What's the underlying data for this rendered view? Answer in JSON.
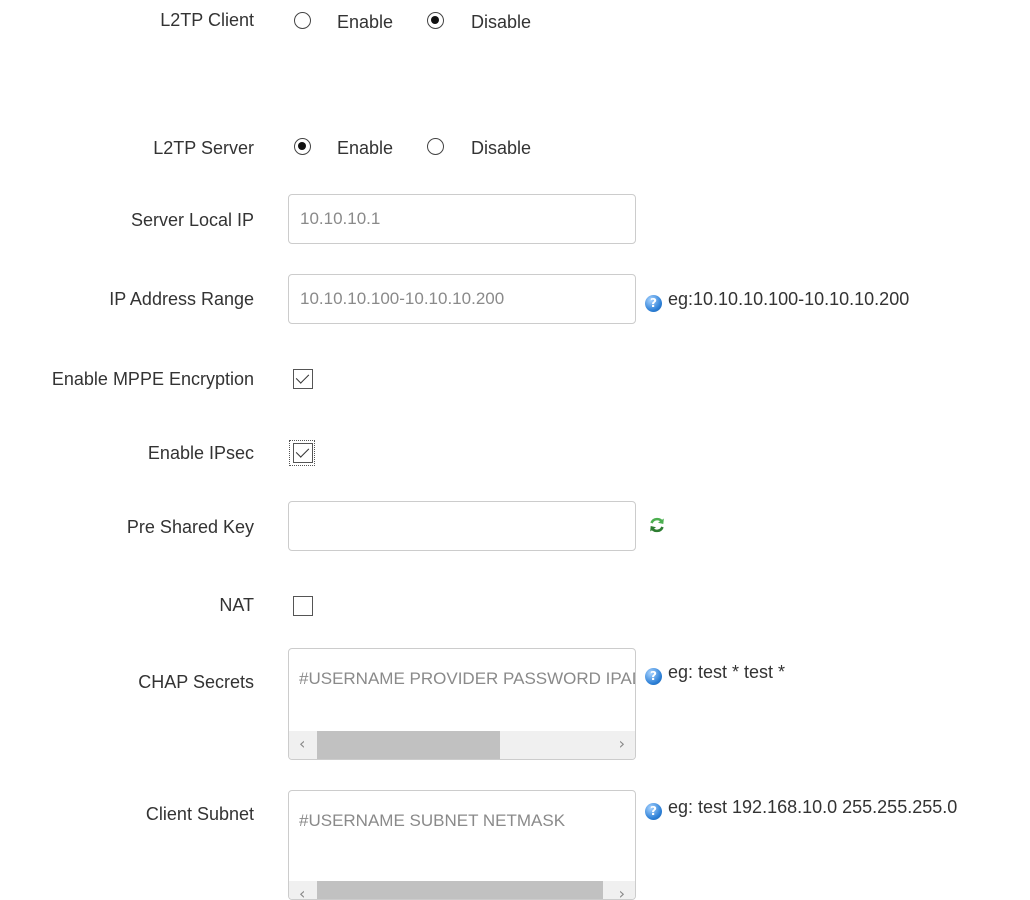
{
  "l2tp_client": {
    "label": "L2TP Client",
    "options": [
      {
        "label": "Enable",
        "selected": false
      },
      {
        "label": "Disable",
        "selected": true
      }
    ]
  },
  "l2tp_server": {
    "label": "L2TP Server",
    "options": [
      {
        "label": "Enable",
        "selected": true
      },
      {
        "label": "Disable",
        "selected": false
      }
    ]
  },
  "server_local_ip": {
    "label": "Server Local IP",
    "value": "10.10.10.1"
  },
  "ip_address_range": {
    "label": "IP Address Range",
    "value": "10.10.10.100-10.10.10.200",
    "help": "eg:10.10.10.100-10.10.10.200"
  },
  "mppe": {
    "label": "Enable MPPE Encryption",
    "checked": true
  },
  "ipsec": {
    "label": "Enable IPsec",
    "checked": true
  },
  "pre_shared_key": {
    "label": "Pre Shared Key",
    "value": ""
  },
  "nat": {
    "label": "NAT",
    "checked": false
  },
  "chap_secrets": {
    "label": "CHAP Secrets",
    "value": "#USERNAME  PROVIDER  PASSWORD  IPADDRESS",
    "help": "eg: test * test *"
  },
  "client_subnet": {
    "label": "Client Subnet",
    "value": "#USERNAME SUBNET NETMASK",
    "help": "eg: test 192.168.10.0 255.255.255.0"
  },
  "icons": {
    "help": "help-icon",
    "refresh": "refresh-icon"
  },
  "colors": {
    "help_icon": "#2c7fd6",
    "refresh_icon": "#4caf50",
    "input_border": "#cccccc"
  }
}
